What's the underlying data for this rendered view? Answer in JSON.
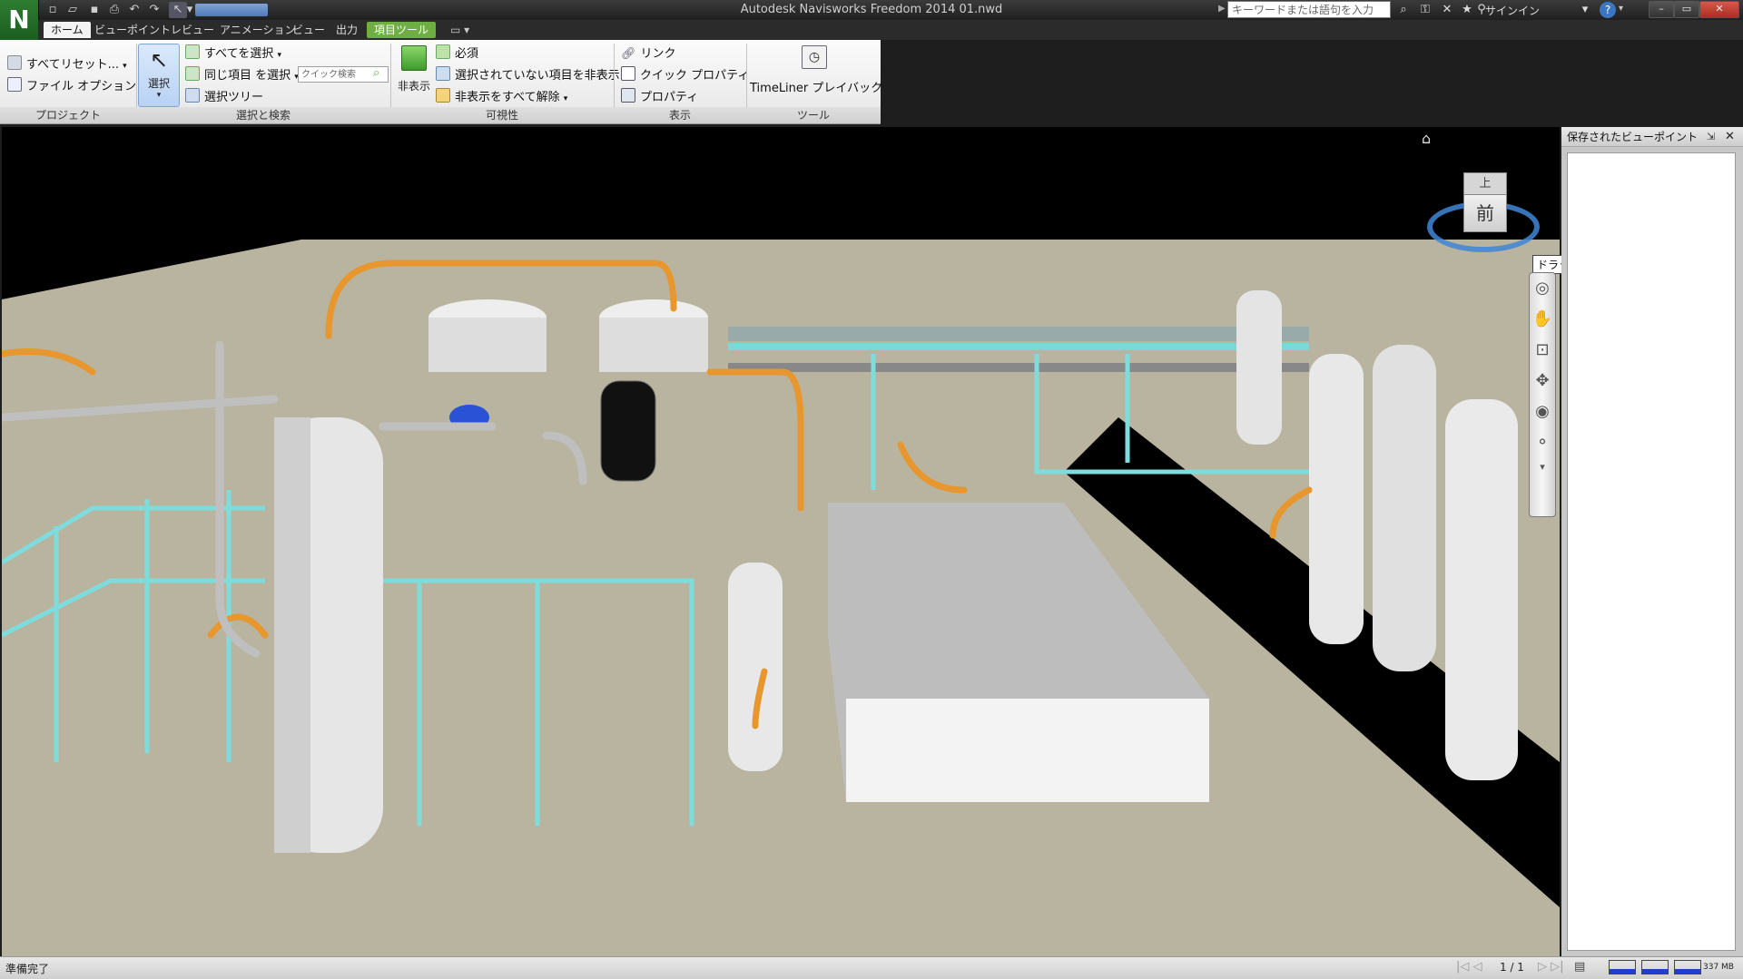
{
  "titlebar": {
    "title": "Autodesk Navisworks Freedom 2014    01.nwd",
    "search_placeholder": "キーワードまたは語句を入力",
    "signin": "サインイン",
    "help": "?",
    "minimize": "–",
    "restore": "▭",
    "close": "✕"
  },
  "tabs": [
    "ホーム",
    "ビューポイント",
    "レビュー",
    "アニメーション",
    "ビュー",
    "出力",
    "項目ツール"
  ],
  "ribbon": {
    "project": {
      "title": "プロジェクト",
      "reset_all": "すべてリセット...",
      "file_options": "ファイル オプション"
    },
    "select_search": {
      "title": "選択と検索",
      "select": "選択",
      "select_all": "すべてを選択",
      "select_same": "同じ項目 を選択",
      "selection_tree": "選択ツリー",
      "quick_search_placeholder": "クイック検索"
    },
    "visibility": {
      "title": "可視性",
      "hide": "非表示",
      "required": "必須",
      "hide_unselected": "選択されていない項目を非表示",
      "unhide_all": "非表示をすべて解除"
    },
    "display": {
      "title": "表示",
      "links": "リンク",
      "quick_properties": "クイック プロパティ",
      "properties": "プロパティ"
    },
    "tools": {
      "title": "ツール",
      "timeliner": "TimeLiner プレイバック"
    }
  },
  "viewport": {
    "viewcube_face": "前",
    "viewcube_top": "上",
    "tooltip": "ドラッグ"
  },
  "side_pane": {
    "title": "保存されたビューポイント"
  },
  "statusbar": {
    "status": "準備完了",
    "page": "1 / 1",
    "memory": "337 MB"
  }
}
